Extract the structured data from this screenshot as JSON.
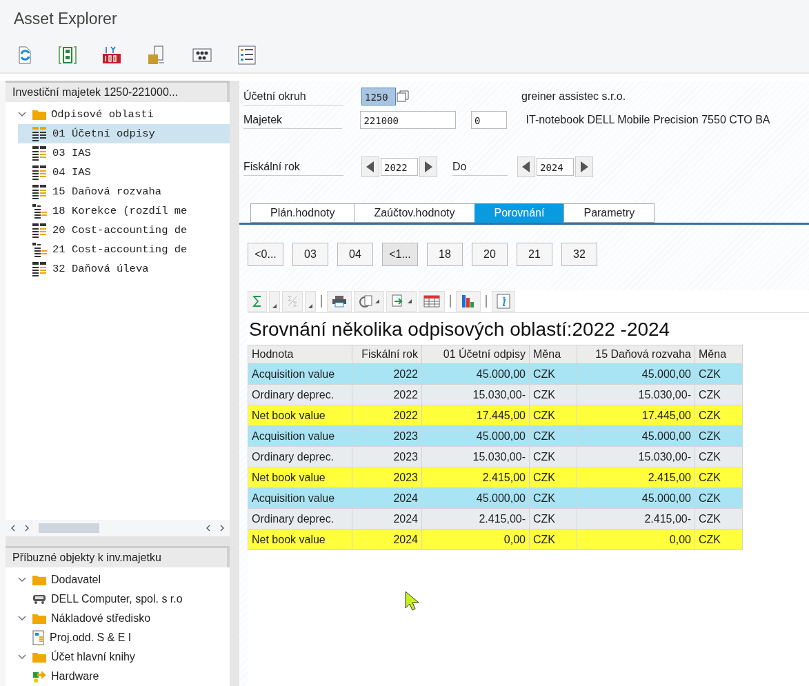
{
  "window": {
    "title": "Asset Explorer"
  },
  "asset_tree": {
    "header": "Investiční majetek 1250-221000...",
    "root": {
      "label": "Odpisové oblasti",
      "expanded": true,
      "children": [
        {
          "label": "01 Účetní odpisy",
          "kind": "area",
          "selected": true
        },
        {
          "label": "03 IAS",
          "kind": "area",
          "selected": false
        },
        {
          "label": "04 IAS",
          "kind": "area",
          "selected": false
        },
        {
          "label": "15 Daňová rozvaha",
          "kind": "area",
          "selected": false
        },
        {
          "label": "18 Korekce (rozdíl me",
          "kind": "derived",
          "selected": false
        },
        {
          "label": "20 Cost-accounting de",
          "kind": "area",
          "selected": false
        },
        {
          "label": "21 Cost-accounting de",
          "kind": "derived",
          "selected": false
        },
        {
          "label": "32 Daňová úleva",
          "kind": "area",
          "selected": false
        }
      ]
    }
  },
  "related": {
    "header": "Příbuzné objekty k inv.majetku",
    "groups": [
      {
        "label": "Dodavatel",
        "expanded": true,
        "children": [
          {
            "label": "DELL Computer, spol. s r.o",
            "kind": "vendor"
          }
        ]
      },
      {
        "label": "Nákladové středisko",
        "expanded": true,
        "children": [
          {
            "label": "Proj.odd. S & E I",
            "kind": "cost-center"
          }
        ]
      },
      {
        "label": "Účet hlavní knihy",
        "expanded": true,
        "children": [
          {
            "label": "Hardware",
            "kind": "account"
          }
        ]
      }
    ]
  },
  "company_code": {
    "label": "Účetní okruh",
    "value": "1250",
    "description": "greiner assistec s.r.o."
  },
  "asset": {
    "label": "Majetek",
    "value": "221000",
    "subnumber": "0",
    "description": "IT-notebook DELL Mobile Precision 7550 CTO BA"
  },
  "fiscal_year": {
    "label": "Fiskální rok",
    "from": "2022",
    "to_label": "Do",
    "to": "2024"
  },
  "tabs": [
    {
      "label": "Plán.hodnoty",
      "selected": false
    },
    {
      "label": "Zaúčtov.hodnoty",
      "selected": false
    },
    {
      "label": "Porovnání",
      "selected": true
    },
    {
      "label": "Parametry",
      "selected": false
    }
  ],
  "area_buttons": [
    {
      "label": "<0...",
      "selected": false
    },
    {
      "label": "03",
      "selected": false
    },
    {
      "label": "04",
      "selected": false
    },
    {
      "label": "<1...",
      "selected": true
    },
    {
      "label": "18",
      "selected": false
    },
    {
      "label": "20",
      "selected": false
    },
    {
      "label": "21",
      "selected": false
    },
    {
      "label": "32",
      "selected": false
    }
  ],
  "report": {
    "title": "Srovnání několika odpisových oblastí:2022 -2024",
    "columns": [
      "Hodnota",
      "Fiskální rok",
      "01 Účetní odpisy",
      "Měna",
      "15 Daňová rozvaha",
      "Měna"
    ],
    "rows": [
      {
        "cells": [
          "Acquisition value",
          "2022",
          "45.000,00",
          "CZK",
          "45.000,00",
          "CZK"
        ],
        "color": "#a8e4f4"
      },
      {
        "cells": [
          "Ordinary deprec.",
          "2022",
          "15.030,00-",
          "CZK",
          "15.030,00-",
          "CZK"
        ],
        "color": "#e9ecef"
      },
      {
        "cells": [
          "Net book value",
          "2022",
          "17.445,00",
          "CZK",
          "17.445,00",
          "CZK"
        ],
        "color": "#ffff3c"
      },
      {
        "cells": [
          "Acquisition value",
          "2023",
          "45.000,00",
          "CZK",
          "45.000,00",
          "CZK"
        ],
        "color": "#a8e4f4"
      },
      {
        "cells": [
          "Ordinary deprec.",
          "2023",
          "15.030,00-",
          "CZK",
          "15.030,00-",
          "CZK"
        ],
        "color": "#e9ecef"
      },
      {
        "cells": [
          "Net book value",
          "2023",
          "2.415,00",
          "CZK",
          "2.415,00",
          "CZK"
        ],
        "color": "#ffff3c"
      },
      {
        "cells": [
          "Acquisition value",
          "2024",
          "45.000,00",
          "CZK",
          "45.000,00",
          "CZK"
        ],
        "color": "#a8e4f4"
      },
      {
        "cells": [
          "Ordinary deprec.",
          "2024",
          "2.415,00-",
          "CZK",
          "2.415,00-",
          "CZK"
        ],
        "color": "#e9ecef"
      },
      {
        "cells": [
          "Net book value",
          "2024",
          "0,00",
          "CZK",
          "0,00",
          "CZK"
        ],
        "color": "#ffff3c"
      }
    ]
  }
}
